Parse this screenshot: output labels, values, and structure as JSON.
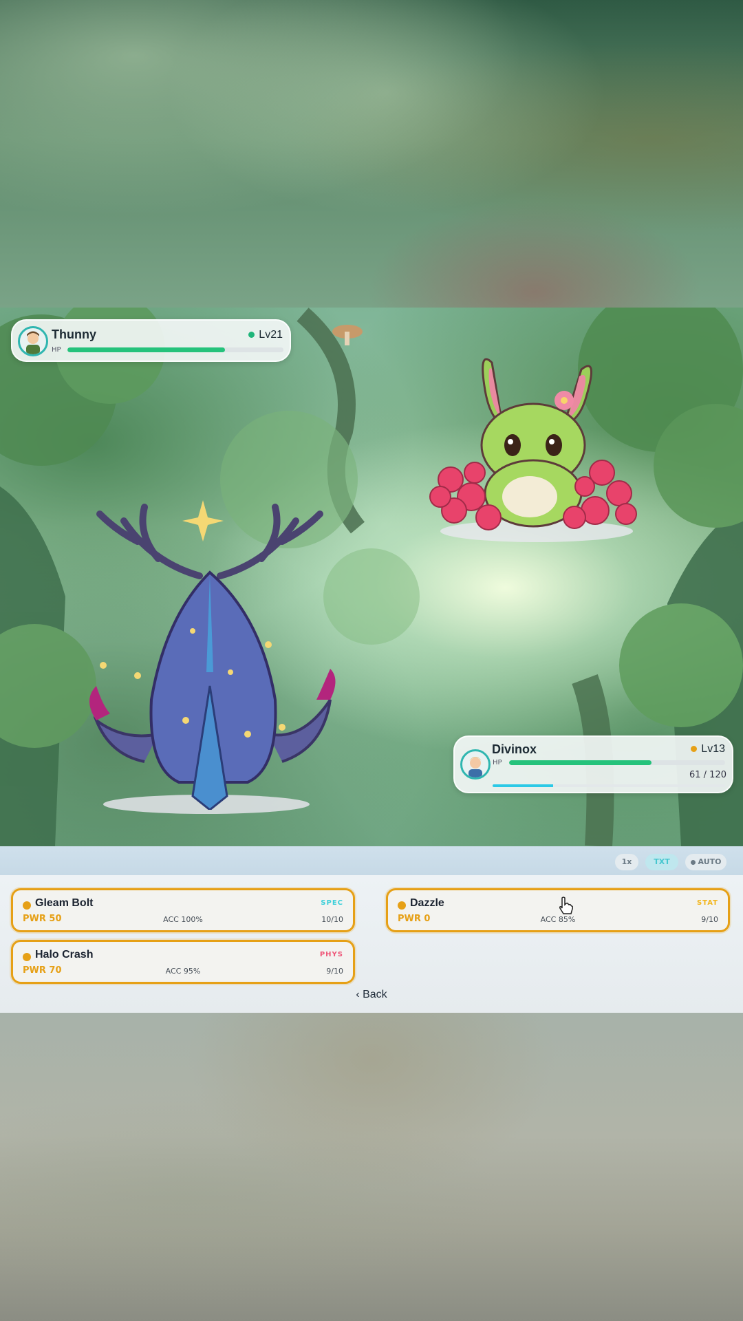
{
  "player": {
    "name": "Thunny",
    "level": "Lv21",
    "hp_label": "HP",
    "hp_fraction": 0.73,
    "status_color": "#1fb57a"
  },
  "enemy": {
    "name": "Divinox",
    "level": "Lv13",
    "hp_label": "HP",
    "hp_text": "61 / 120",
    "hp_fraction": 0.66,
    "xp_fraction": 0.26,
    "status_color": "#e6a016"
  },
  "controls": {
    "speed": "1x",
    "text": "TXT",
    "auto": "AUTO"
  },
  "moves": [
    {
      "name": "Gleam Bolt",
      "type": "SPEC",
      "type_color": "#3ccfd9",
      "power": "PWR 50",
      "accuracy": "ACC 100%",
      "pp": "10/10"
    },
    {
      "name": "Dazzle",
      "type": "STAT",
      "type_color": "#f2b51c",
      "power": "PWR 0",
      "accuracy": "ACC 85%",
      "pp": "9/10"
    },
    {
      "name": "Halo Crash",
      "type": "PHYS",
      "type_color": "#ee5577",
      "power": "PWR 70",
      "accuracy": "ACC 95%",
      "pp": "9/10"
    }
  ],
  "back_label": "‹ Back",
  "accent_color": "#e6a016"
}
